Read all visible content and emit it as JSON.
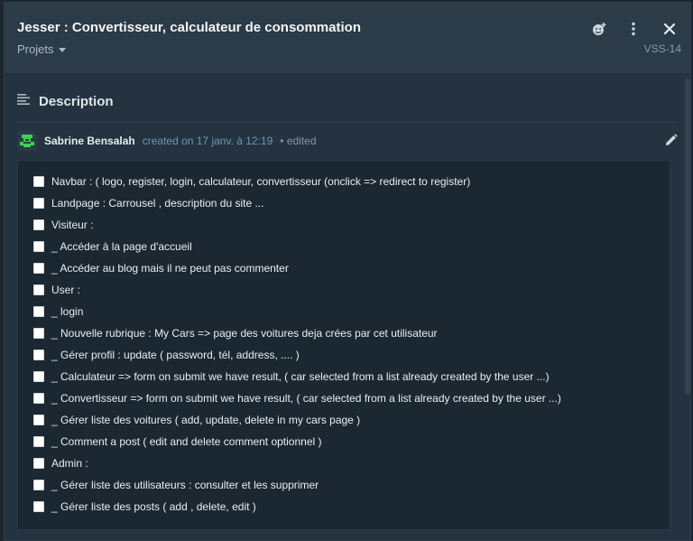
{
  "header": {
    "title": "Jesser : Convertisseur, calculateur de consommation",
    "project_label": "Projets",
    "issue_key": "VSS-14",
    "icons": [
      "add-reaction-icon",
      "more-vertical-icon",
      "close-icon"
    ]
  },
  "description": {
    "heading": "Description",
    "author": "Sabrine Bensalah",
    "created": "created on 17 janv. à 12:19",
    "edited": "• edited",
    "checklist": [
      "Navbar : ( logo, register, login, calculateur, convertisseur (onclick => redirect to register)",
      "Landpage : Carrousel , description du site ...",
      "Visiteur :",
      "_ Accéder à la page d'accueil",
      "_ Accéder au blog mais il ne peut pas commenter",
      "User :",
      "_ login",
      "_ Nouvelle rubrique : My Cars => page des voitures deja crées par cet utilisateur",
      "_ Gérer profil : update ( password, tél, address, .... )",
      "_ Calculateur => form on submit we have result, ( car selected from a list already created by the user ...)",
      "_ Convertisseur => form on submit we have result, ( car selected from a list already created by the user ...)",
      "_ Gérer liste des voitures ( add, update, delete in my cars page )",
      "_ Comment a post ( edit and delete comment optionnel )",
      "Admin :",
      "_ Gérer liste des utilisateurs : consulter et les supprimer",
      "_ Gérer liste des posts ( add , delete, edit )"
    ]
  },
  "colors": {
    "background": "#24333f",
    "header": "#2b3b48",
    "checklist_bg": "#1c2831",
    "meta_link": "#6f97b2",
    "avatar_green": "#3fd04f"
  }
}
